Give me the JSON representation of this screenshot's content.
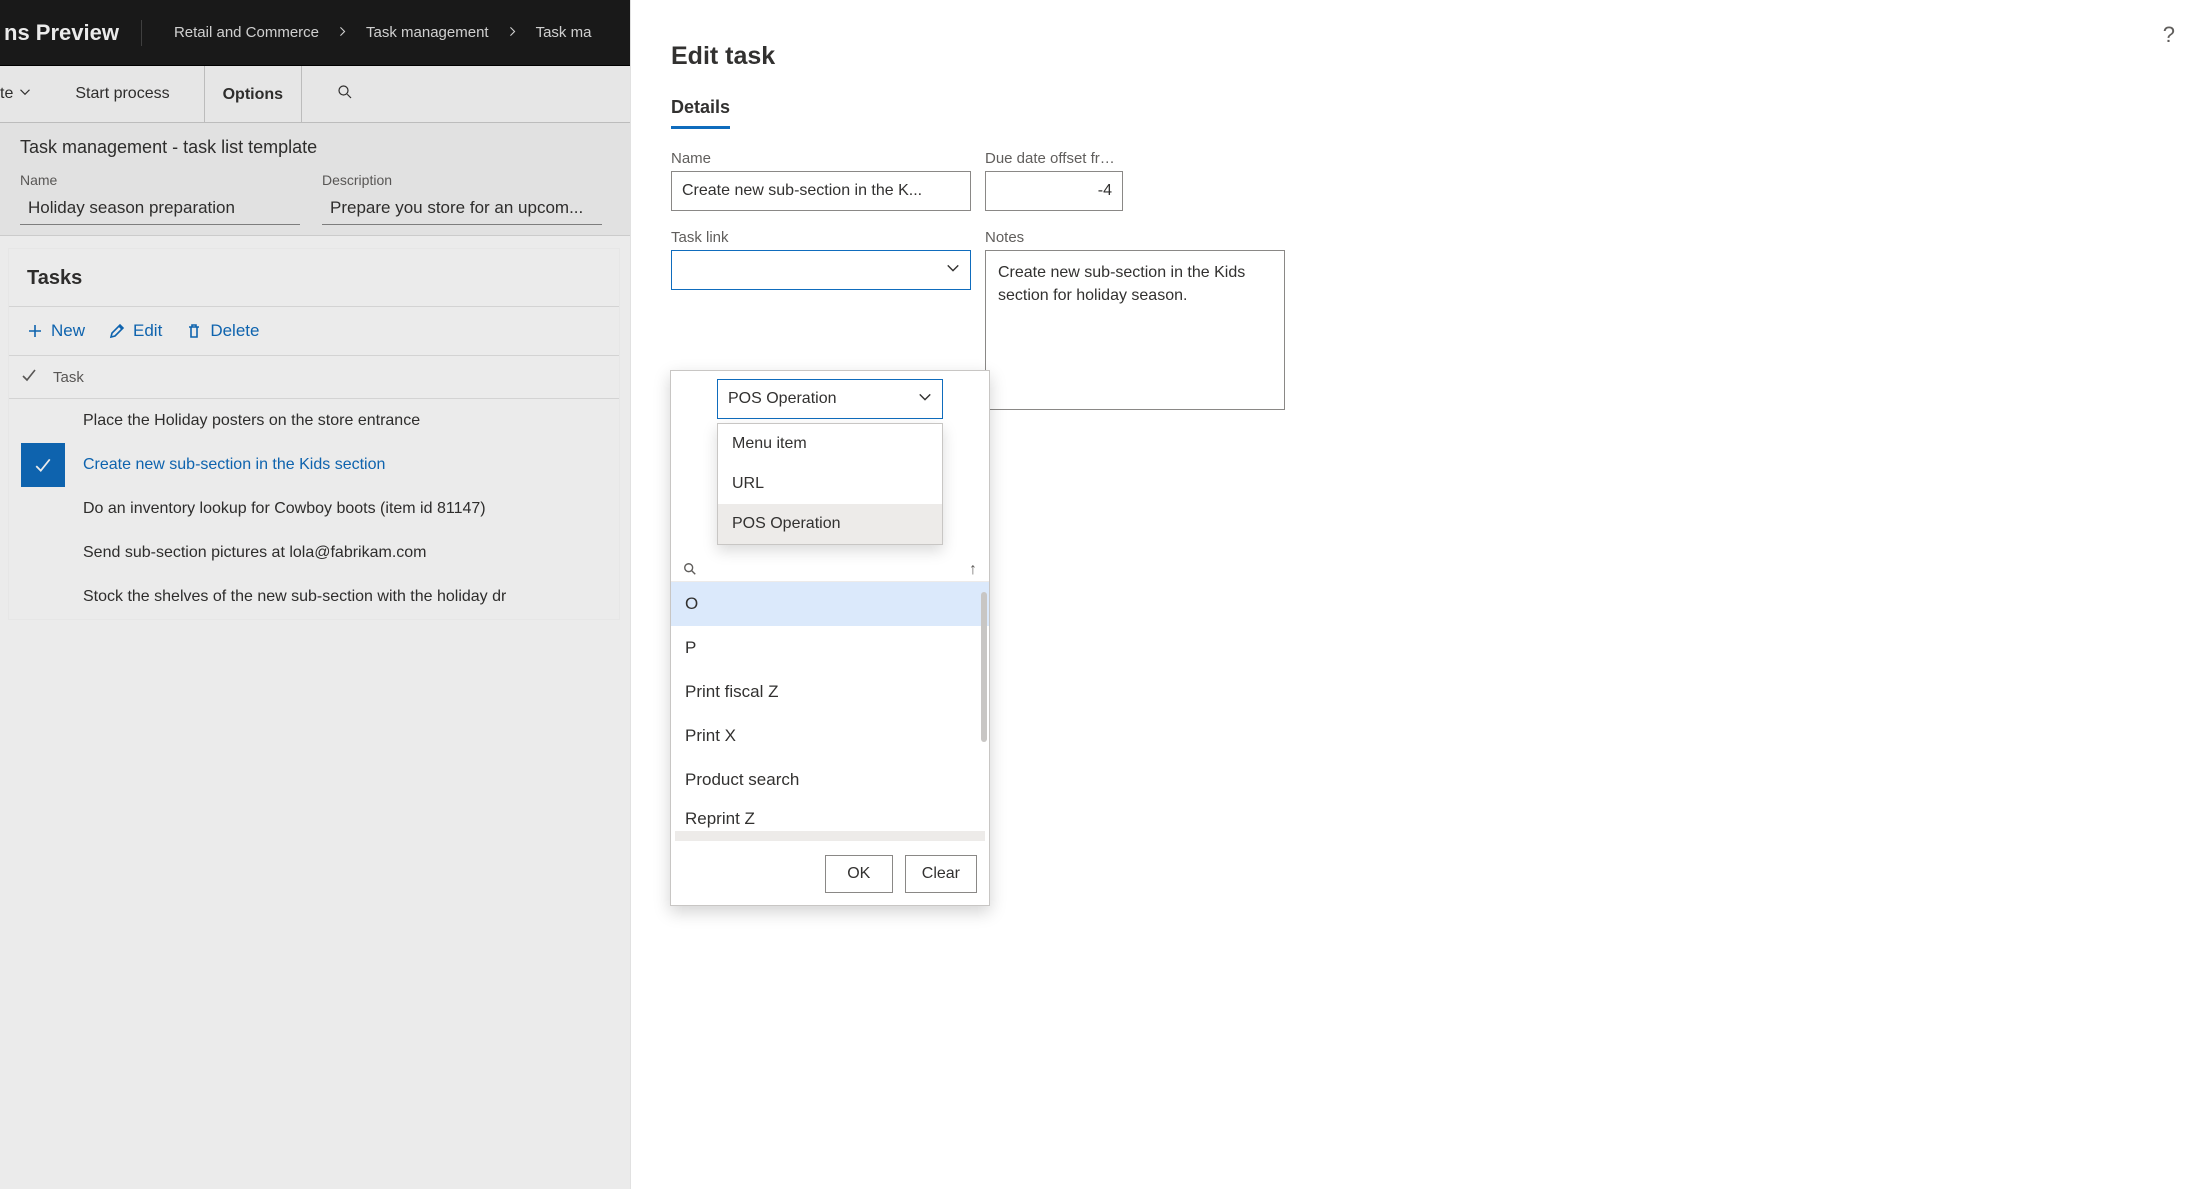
{
  "topbar": {
    "title_fragment": "ns Preview",
    "breadcrumbs": [
      "Retail and Commerce",
      "Task management",
      "Task ma"
    ]
  },
  "actions": {
    "item0": "te",
    "start_process": "Start process",
    "options": "Options"
  },
  "page": {
    "header": "Task management - task list template",
    "name_label": "Name",
    "name_value": "Holiday season preparation",
    "desc_label": "Description",
    "desc_value": "Prepare you store for an upcom..."
  },
  "tasks": {
    "section_title": "Tasks",
    "new_label": "New",
    "edit_label": "Edit",
    "delete_label": "Delete",
    "column_task": "Task",
    "rows": [
      {
        "text": "Place the Holiday posters on the store entrance",
        "selected": false
      },
      {
        "text": "Create new sub-section in the Kids section",
        "selected": true
      },
      {
        "text": "Do an inventory lookup for Cowboy boots (item id 81147)",
        "selected": false
      },
      {
        "text": "Send sub-section pictures at lola@fabrikam.com",
        "selected": false
      },
      {
        "text": "Stock the shelves of the new sub-section with the holiday dr",
        "selected": false
      }
    ]
  },
  "panel": {
    "title": "Edit task",
    "tab_details": "Details",
    "name_label": "Name",
    "name_value": "Create new sub-section in the K...",
    "due_label": "Due date offset from target date (+/- ...",
    "due_value": "-4",
    "tasklink_label": "Task link",
    "tasklink_value": "",
    "notes_label": "Notes",
    "notes_value": "Create new sub-section in the Kids section for holiday season.",
    "help": "?"
  },
  "flyout": {
    "type_selected": "POS Operation",
    "type_options": [
      "Menu item",
      "URL",
      "POS Operation"
    ],
    "operations": [
      {
        "label": "O",
        "highlight": true,
        "cut": true
      },
      {
        "label": "P",
        "cut": true
      },
      {
        "label": "Print fiscal Z"
      },
      {
        "label": "Print X"
      },
      {
        "label": "Product search"
      },
      {
        "label": "Reprint Z",
        "partial": true
      }
    ],
    "sort_glyph": "↑",
    "ok": "OK",
    "clear": "Clear"
  },
  "chart_data": null
}
